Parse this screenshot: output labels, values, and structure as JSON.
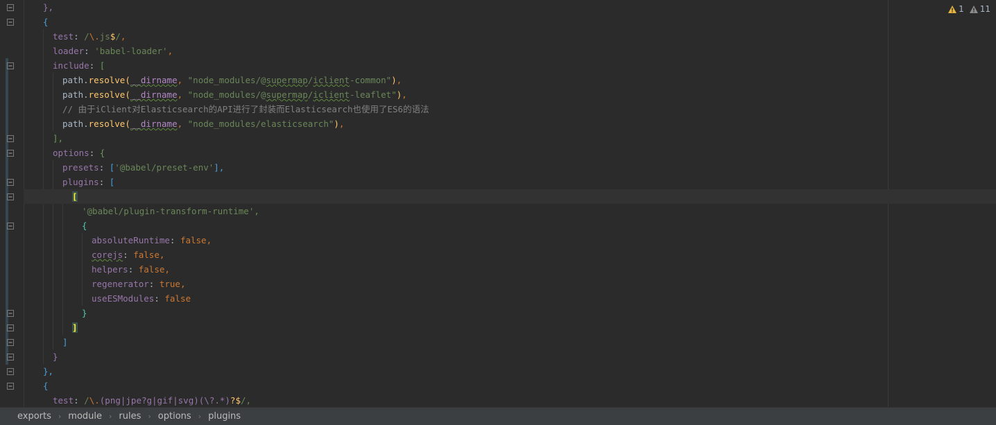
{
  "inspections": {
    "warnings": {
      "icon": "warning-icon",
      "count": "1",
      "color": "#e8b53f"
    },
    "weak_warnings": {
      "icon": "weak-warning-icon",
      "count": "11",
      "color": "#8c8c8c"
    }
  },
  "breadcrumb": [
    "exports",
    "module",
    "rules",
    "options",
    "plugins"
  ],
  "code": {
    "l01_close": "},",
    "l02_open": "{",
    "l03_test_key": "test",
    "l03_regex_open": "/",
    "l03_regex_esc": "\\.",
    "l03_regex_body": "js",
    "l03_regex_end": "$",
    "l03_regex_close": "/",
    "l04_loader_key": "loader",
    "l04_loader_val": "'babel-loader'",
    "l05_include_key": "include",
    "l05_include_open": "[",
    "l06_path": "path",
    "l06_resolve": "resolve",
    "l06_dirname": "__dirname",
    "l06_str_a": "\"node_modules/@",
    "l06_str_b": "supermap",
    "l06_str_c": "/",
    "l06_str_d": "iclient",
    "l06_str_e": "-common\"",
    "l07_path": "path",
    "l07_resolve": "resolve",
    "l07_dirname": "__dirname",
    "l07_str_a": "\"node_modules/@",
    "l07_str_b": "supermap",
    "l07_str_c": "/",
    "l07_str_d": "iclient",
    "l07_str_e": "-leaflet\"",
    "l08_comment": "// 由于iClient对Elasticsearch的API进行了封装而Elasticsearch也使用了ES6的语法",
    "l09_path": "path",
    "l09_resolve": "resolve",
    "l09_dirname": "__dirname",
    "l09_str": "\"node_modules/elasticsearch\"",
    "l10_close": "],",
    "l11_options_key": "options",
    "l11_open": "{",
    "l12_presets_key": "presets",
    "l12_open": "[",
    "l12_val": "'@babel/preset-env'",
    "l12_close": "],",
    "l13_plugins_key": "plugins",
    "l13_open": "[",
    "l14_open": "[",
    "l15_val": "'@babel/plugin-transform-runtime',",
    "l16_open": "{",
    "l17_key": "absoluteRuntime",
    "l17_val": "false,",
    "l18_key": "corejs",
    "l18_val": "false,",
    "l19_key": "helpers",
    "l19_val": "false,",
    "l20_key": "regenerator",
    "l20_val": "true,",
    "l21_key": "useESModules",
    "l21_val": "false",
    "l22_close": "}",
    "l23_close": "]",
    "l24_close": "]",
    "l25_close": "}",
    "l26_close": "},",
    "l27_open": "{",
    "l28_test_key": "test",
    "l28_regex_open": "/",
    "l28_regex_esc": "\\.",
    "l28_regex_group": "(png|jpe?g|gif|svg)",
    "l28_regex_group2": "(\\?.*)",
    "l28_regex_tail": "?$",
    "l28_regex_close": "/,"
  }
}
